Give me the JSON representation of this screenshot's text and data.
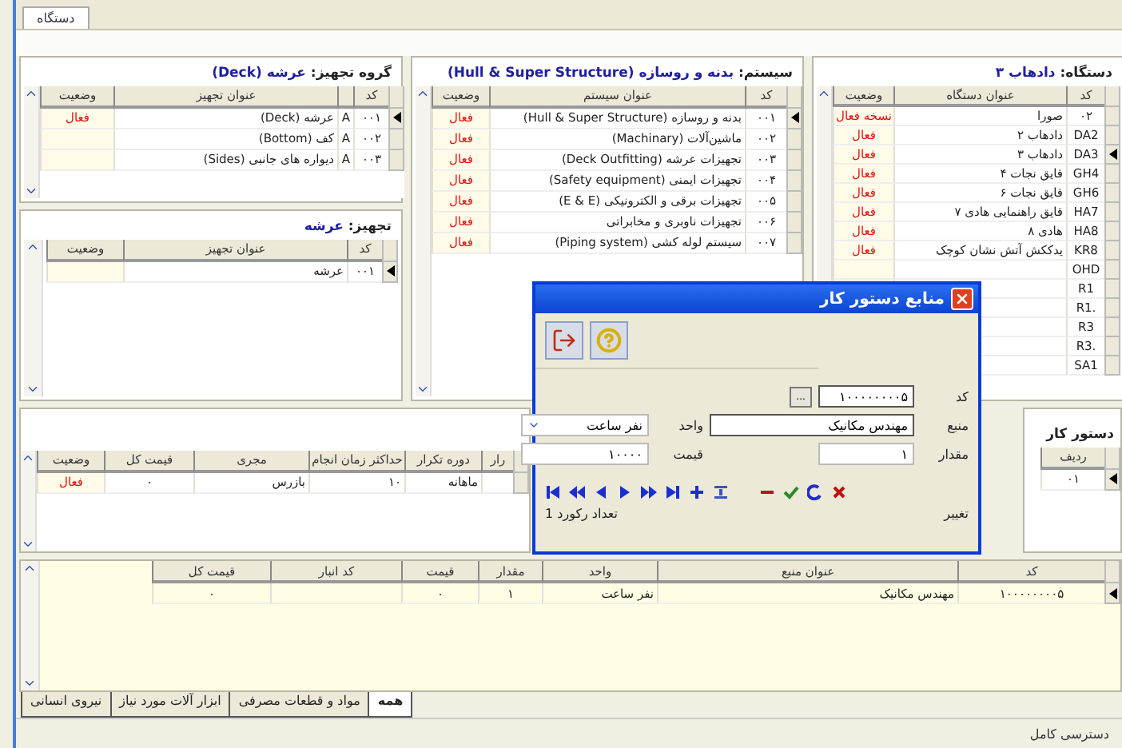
{
  "top_tabs": [
    {
      "label": "دستگاه",
      "selected": true
    }
  ],
  "equipment_group": {
    "title_label": "گروه تجهیز:",
    "title_value": "عرشه (Deck)",
    "table": {
      "columns": [
        {
          "label": "کد",
          "kind": "code"
        },
        {
          "kind": "flag"
        },
        {
          "label": "عنوان تجهیز",
          "kind": "text"
        },
        {
          "label": "وضعیت",
          "kind": "status"
        }
      ],
      "rows": [
        {
          "selected": true,
          "cells": [
            "۰۰۱",
            "A",
            "عرشه (Deck)",
            "فعال"
          ]
        },
        {
          "selected": false,
          "cells": [
            "۰۰۲",
            "A",
            "کف (Bottom)",
            null
          ]
        },
        {
          "selected": false,
          "cells": [
            "۰۰۳",
            "A",
            "دیواره های جانبی (Sides)",
            null
          ]
        }
      ]
    }
  },
  "equipment": {
    "title_label": "تجهیز:",
    "title_value": "عرشه",
    "table": {
      "columns": [
        {
          "label": "کد",
          "kind": "code"
        },
        {
          "label": "عنوان تجهیز",
          "kind": "text"
        },
        {
          "label": "وضعیت",
          "kind": "status"
        }
      ],
      "rows": [
        {
          "selected": true,
          "cells": [
            "۰۰۱",
            "عرشه",
            null
          ]
        }
      ]
    }
  },
  "system": {
    "title_label": "سیستم:",
    "title_value": "بدنه و روسازه (Hull & Super Structure)",
    "table": {
      "columns": [
        {
          "label": "کد",
          "kind": "code"
        },
        {
          "label": "عنوان سیستم",
          "kind": "text"
        },
        {
          "label": "وضعیت",
          "kind": "status"
        }
      ],
      "rows": [
        {
          "selected": true,
          "cells": [
            "۰۰۱",
            "بدنه و روسازه (Hull & Super Structure)",
            "فعال"
          ]
        },
        {
          "selected": false,
          "cells": [
            "۰۰۲",
            "ماشین‌آلات (Machinary)",
            "فعال"
          ]
        },
        {
          "selected": false,
          "cells": [
            "۰۰۳",
            "تجهیزات عرشه (Deck Outfitting)",
            "فعال"
          ]
        },
        {
          "selected": false,
          "cells": [
            "۰۰۴",
            "تجهیزات ایمنی (Safety equipment)",
            "فعال"
          ]
        },
        {
          "selected": false,
          "cells": [
            "۰۰۵",
            "تجهیزات برقی و الکترونیکی (E & E)",
            "فعال"
          ]
        },
        {
          "selected": false,
          "cells": [
            "۰۰۶",
            "تجهیزات ناوبری و مخابراتی",
            "فعال"
          ]
        },
        {
          "selected": false,
          "cells": [
            "۰۰۷",
            "سیستم لوله کشی (Piping system)",
            "فعال"
          ]
        }
      ]
    }
  },
  "device": {
    "title_label": "دستگاه:",
    "title_value": "دادهاب ۳",
    "table": {
      "columns": [
        {
          "label": "کد",
          "kind": "code"
        },
        {
          "label": "عنوان دستگاه",
          "kind": "text"
        },
        {
          "label": "وضعیت",
          "kind": "status"
        }
      ],
      "rows": [
        {
          "selected": false,
          "cells": [
            "۰۲",
            "صورا",
            "نسخه فعال"
          ]
        },
        {
          "selected": false,
          "cells": [
            "DA2",
            "دادهاب ۲",
            "فعال"
          ]
        },
        {
          "selected": true,
          "cells": [
            "DA3",
            "دادهاب ۳",
            "فعال"
          ]
        },
        {
          "selected": false,
          "cells": [
            "GH4",
            "قایق نجات ۴",
            "فعال"
          ]
        },
        {
          "selected": false,
          "cells": [
            "GH6",
            "قایق نجات ۶",
            "فعال"
          ]
        },
        {
          "selected": false,
          "cells": [
            "HA7",
            "قایق راهنمایی هادی ۷",
            "فعال"
          ]
        },
        {
          "selected": false,
          "cells": [
            "HA8",
            "هادی ۸",
            "فعال"
          ]
        },
        {
          "selected": false,
          "cells": [
            "KR8",
            "یدککش آتش نشان کوچک",
            "فعال"
          ]
        },
        {
          "selected": false,
          "cells": [
            "OHD",
            null,
            null
          ]
        },
        {
          "selected": false,
          "cells": [
            "R1",
            null,
            null
          ]
        },
        {
          "selected": false,
          "cells": [
            ".R1",
            null,
            null
          ]
        },
        {
          "selected": false,
          "cells": [
            "R3",
            null,
            null
          ]
        },
        {
          "selected": false,
          "cells": [
            ".R3",
            null,
            null
          ]
        },
        {
          "selected": false,
          "cells": [
            "SA1",
            null,
            null
          ]
        }
      ]
    }
  },
  "work_order_details": {
    "table": {
      "columns": [
        {
          "label": "رار",
          "kind": "text"
        },
        {
          "label": "دوره تکرار",
          "kind": "text"
        },
        {
          "label": "حداکثر زمان انجام",
          "kind": "text"
        },
        {
          "label": "مجری",
          "kind": "text"
        },
        {
          "label": "قیمت کل",
          "kind": "num"
        },
        {
          "label": "وضعیت",
          "kind": "status"
        }
      ],
      "rows": [
        {
          "selected": false,
          "cells": [
            null,
            "ماهانه",
            "۱۰",
            "بازرس",
            "۰",
            "فعال"
          ]
        }
      ]
    }
  },
  "work_order": {
    "title": "دستور کار",
    "table": {
      "columns": [
        {
          "label": "ردیف",
          "kind": "code"
        }
      ],
      "rows": [
        {
          "selected": true,
          "cells": [
            "۰۱"
          ]
        }
      ]
    }
  },
  "resources": {
    "table": {
      "columns": [
        {
          "label": "کد",
          "kind": "code"
        },
        {
          "label": "عنوان منبع",
          "kind": "text"
        },
        {
          "label": "واحد",
          "kind": "text"
        },
        {
          "label": "مقدار",
          "kind": "num"
        },
        {
          "label": "قیمت",
          "kind": "num"
        },
        {
          "label": "کد انبار",
          "kind": "text"
        },
        {
          "label": "قیمت کل",
          "kind": "num"
        }
      ],
      "rows": [
        {
          "selected": true,
          "cells": [
            "۱۰۰۰۰۰۰۰۰۵",
            "مهندس مکانیک",
            "نفر ساعت",
            "۱",
            "۰",
            null,
            "۰"
          ]
        }
      ]
    }
  },
  "bottom_tabs": [
    {
      "label": "همه",
      "selected": true
    },
    {
      "label": "مواد و قطعات مصرفی",
      "selected": false
    },
    {
      "label": "ابزار آلات مورد نیاز",
      "selected": false
    },
    {
      "label": "نیروی انسانی",
      "selected": false
    }
  ],
  "dialog": {
    "title": "منابع دستور کار",
    "fields": [
      {
        "label": "کد",
        "value": "۱۰۰۰۰۰۰۰۰۵",
        "browse": "..."
      },
      {
        "label": "منبع",
        "value": "مهندس مکانیک"
      },
      {
        "label": "واحد",
        "value": "نفر ساعت"
      },
      {
        "label": "مقدار",
        "value": "۱"
      },
      {
        "label": "قیمت",
        "value": "۱۰۰۰۰"
      }
    ],
    "change_label": "تغییر",
    "record_count": "تعداد رکورد 1"
  },
  "status_bar": {
    "text": "دسترسی کامل"
  }
}
